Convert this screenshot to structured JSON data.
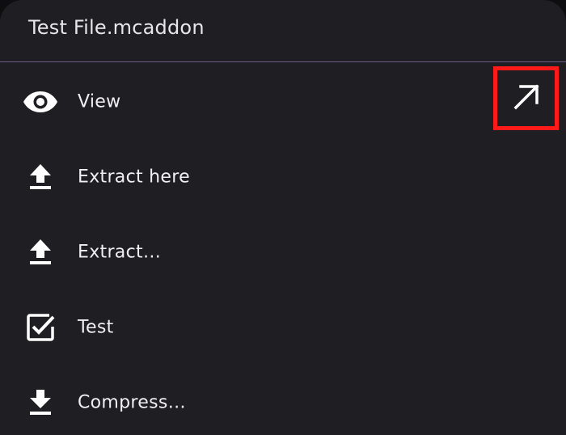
{
  "sheet": {
    "title": "Test File.mcaddon"
  },
  "menu": {
    "items": [
      {
        "label": "View",
        "icon": "eye-icon"
      },
      {
        "label": "Extract here",
        "icon": "upload-icon"
      },
      {
        "label": "Extract…",
        "icon": "upload-icon"
      },
      {
        "label": "Test",
        "icon": "checkbox-icon"
      },
      {
        "label": "Compress…",
        "icon": "download-icon"
      }
    ],
    "open_external_icon": "arrow-up-right-icon"
  },
  "colors": {
    "background": "#1f1e22",
    "divider": "#6e5a86",
    "text": "#f1eff4",
    "highlight_border": "#ff1a1a"
  }
}
